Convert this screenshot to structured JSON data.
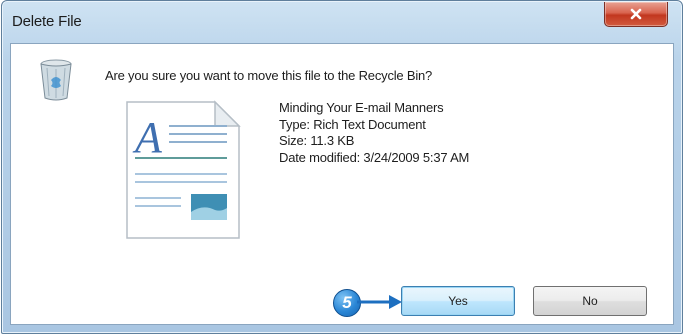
{
  "window": {
    "title": "Delete File",
    "close_icon": "close-icon"
  },
  "dialog": {
    "question": "Are you sure you want to move this file to the Recycle Bin?",
    "icon": "recycle-bin-icon",
    "file_icon": "rich-text-document-icon",
    "file": {
      "name": "Minding Your E-mail Manners",
      "type": "Type: Rich Text Document",
      "size": "Size: 11.3 KB",
      "modified": "Date modified: 3/24/2009 5:37 AM"
    }
  },
  "buttons": {
    "yes": "Yes",
    "no": "No"
  },
  "callout": {
    "step": "5"
  },
  "colors": {
    "title_bar": "#b9d3ea",
    "close_button": "#c2371f",
    "callout": "#2b87d6",
    "default_button": "#bee6fd"
  }
}
